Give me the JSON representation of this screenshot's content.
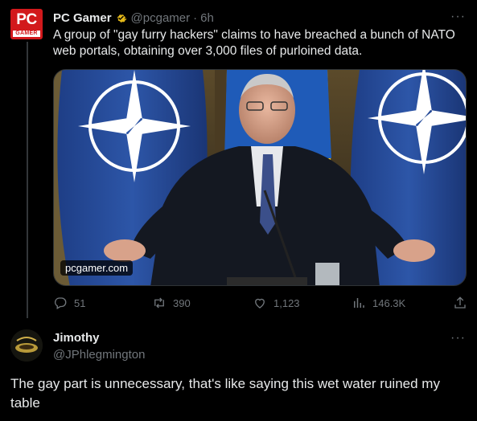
{
  "tweet": {
    "author_name": "PC Gamer",
    "author_handle": "@pcgamer",
    "separator": "·",
    "time": "6h",
    "more": "···",
    "logo_text_top": "PC",
    "logo_text_bottom": "GAMER",
    "text": "A group of \"gay furry hackers\" claims to have breached a bunch of NATO web portals, obtaining over 3,000 files of purloined data.",
    "media_domain": "pcgamer.com",
    "stats": {
      "replies": "51",
      "retweets": "390",
      "likes": "1,123",
      "views": "146.3K"
    }
  },
  "reply": {
    "author_name": "Jimothy",
    "author_handle": "@JPhlegmington",
    "more": "···",
    "text": "The gay part is unnecessary, that's like saying this wet water ruined my table"
  },
  "colors": {
    "background": "#000000",
    "text_primary": "#e7e9ea",
    "text_secondary": "#71767b",
    "verified_gold": "#e2b719",
    "brand_red": "#d2191c"
  }
}
